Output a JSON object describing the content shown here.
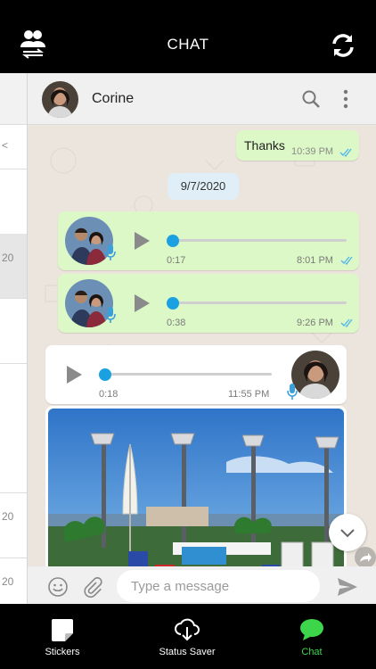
{
  "app": {
    "title": "CHAT"
  },
  "topbar": {
    "left_icon": "users-switch-icon",
    "right_icon": "refresh-icon"
  },
  "left_panel": {
    "partial_texts": [
      "<",
      "20",
      "20",
      "20"
    ]
  },
  "chat_header": {
    "contact_name": "Corine",
    "icons": [
      "search-icon",
      "more-vertical-icon"
    ]
  },
  "messages": [
    {
      "type": "text",
      "direction": "out",
      "text": "Thanks",
      "time": "10:39 PM",
      "status": "read"
    },
    {
      "type": "date",
      "text": "9/7/2020"
    },
    {
      "type": "voice",
      "direction": "out",
      "duration": "0:17",
      "time": "8:01 PM",
      "status": "read",
      "progress": 0
    },
    {
      "type": "voice",
      "direction": "out",
      "duration": "0:38",
      "time": "9:26 PM",
      "status": "read",
      "progress": 0
    },
    {
      "type": "voice",
      "direction": "in",
      "duration": "0:18",
      "time": "11:55 PM",
      "progress": 0
    },
    {
      "type": "image",
      "direction": "in"
    }
  ],
  "composer": {
    "placeholder": "Type a message"
  },
  "tabbar": {
    "tabs": [
      {
        "label": "Stickers",
        "icon": "sticker-icon",
        "active": false
      },
      {
        "label": "Status Saver",
        "icon": "cloud-download-icon",
        "active": false
      },
      {
        "label": "Chat",
        "icon": "chat-bubble-icon",
        "active": true
      }
    ]
  },
  "colors": {
    "accent_green": "#3dd64b",
    "bubble_out": "#dcf8c6",
    "tick_blue": "#4fb6ec",
    "knob_blue": "#1ba1e2"
  }
}
